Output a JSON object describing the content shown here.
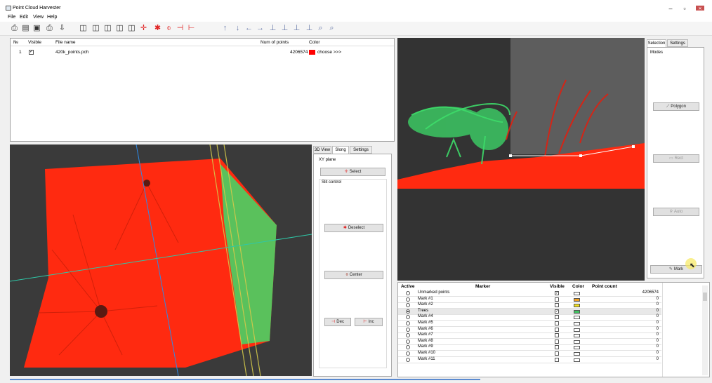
{
  "app": {
    "title": "Point Cloud Harvester"
  },
  "menu": [
    "File",
    "Edit",
    "View",
    "Help"
  ],
  "file_table": {
    "headers": {
      "num": "№",
      "visible": "Visible",
      "file_name": "File name",
      "num_points": "Num of points",
      "color": "Color"
    },
    "rows": [
      {
        "num": "1",
        "visible": true,
        "file_name": "420k_points.pch",
        "num_points": "4206574",
        "color_label": "choose >>>",
        "color": "#ff0000"
      }
    ]
  },
  "mid_tabs": [
    "3D View",
    "Slong",
    "Settings"
  ],
  "slong_panel": {
    "group_title": "XY plane",
    "select_label": "Select",
    "slit_control_title": "Slit control",
    "deselect_label": "Deselect",
    "center_label": "Center",
    "dec_label": "Dec",
    "inc_label": "Inc"
  },
  "right_tabs": [
    "Selection",
    "Settings"
  ],
  "right_panel": {
    "modes_title": "Modes",
    "polygon_label": "Polygon",
    "rect_label": "Rect",
    "auto_label": "Auto",
    "mark_label": "Mark"
  },
  "marker_table": {
    "headers": {
      "active": "Active",
      "marker": "Marker",
      "visible": "Visible",
      "color": "Color",
      "point_count": "Point count"
    },
    "rows": [
      {
        "marker": "Unmarked points",
        "active": false,
        "visible": true,
        "color": "#ffffff",
        "count": "4206574"
      },
      {
        "marker": "Mark #1",
        "active": false,
        "visible": false,
        "color": "#f0a020",
        "count": "0"
      },
      {
        "marker": "Mark #2",
        "active": false,
        "visible": false,
        "color": "#f0e020",
        "count": "0"
      },
      {
        "marker": "Trees",
        "active": true,
        "visible": true,
        "color": "#40c060",
        "count": "0"
      },
      {
        "marker": "Mark #4",
        "active": false,
        "visible": false,
        "color": "#ffffff",
        "count": "0"
      },
      {
        "marker": "Mark #5",
        "active": false,
        "visible": false,
        "color": "#ffffff",
        "count": "0"
      },
      {
        "marker": "Mark #6",
        "active": false,
        "visible": false,
        "color": "#ffffff",
        "count": "0"
      },
      {
        "marker": "Mark #7",
        "active": false,
        "visible": false,
        "color": "#ffffff",
        "count": "0"
      },
      {
        "marker": "Mark #8",
        "active": false,
        "visible": false,
        "color": "#ffffff",
        "count": "0"
      },
      {
        "marker": "Mark #9",
        "active": false,
        "visible": false,
        "color": "#ffffff",
        "count": "0"
      },
      {
        "marker": "Mark #10",
        "active": false,
        "visible": false,
        "color": "#ffffff",
        "count": "0"
      },
      {
        "marker": "Mark #11",
        "active": false,
        "visible": false,
        "color": "#ffffff",
        "count": "0"
      }
    ]
  },
  "colors": {
    "cloud_red": "#ff2a10",
    "cloud_green": "#3ddc6a",
    "viewport_bg": "#3a3a3a"
  },
  "toolbar_icons": [
    "print-icon",
    "new-icon",
    "save-icon",
    "print2-icon",
    "export-icon",
    "cube-view-1-icon",
    "cube-view-2-icon",
    "cube-view-3-icon",
    "cube-view-4-icon",
    "cube-view-5-icon",
    "add-slit-icon",
    "deselect-icon",
    "center-icon",
    "dec-icon",
    "inc-icon",
    "arrow-up-icon",
    "arrow-down-icon",
    "arrow-left-icon",
    "arrow-right-icon",
    "axis-1-icon",
    "axis-2-icon",
    "axis-3-icon",
    "axis-4-icon",
    "zoom-in-icon",
    "zoom-out-icon"
  ]
}
